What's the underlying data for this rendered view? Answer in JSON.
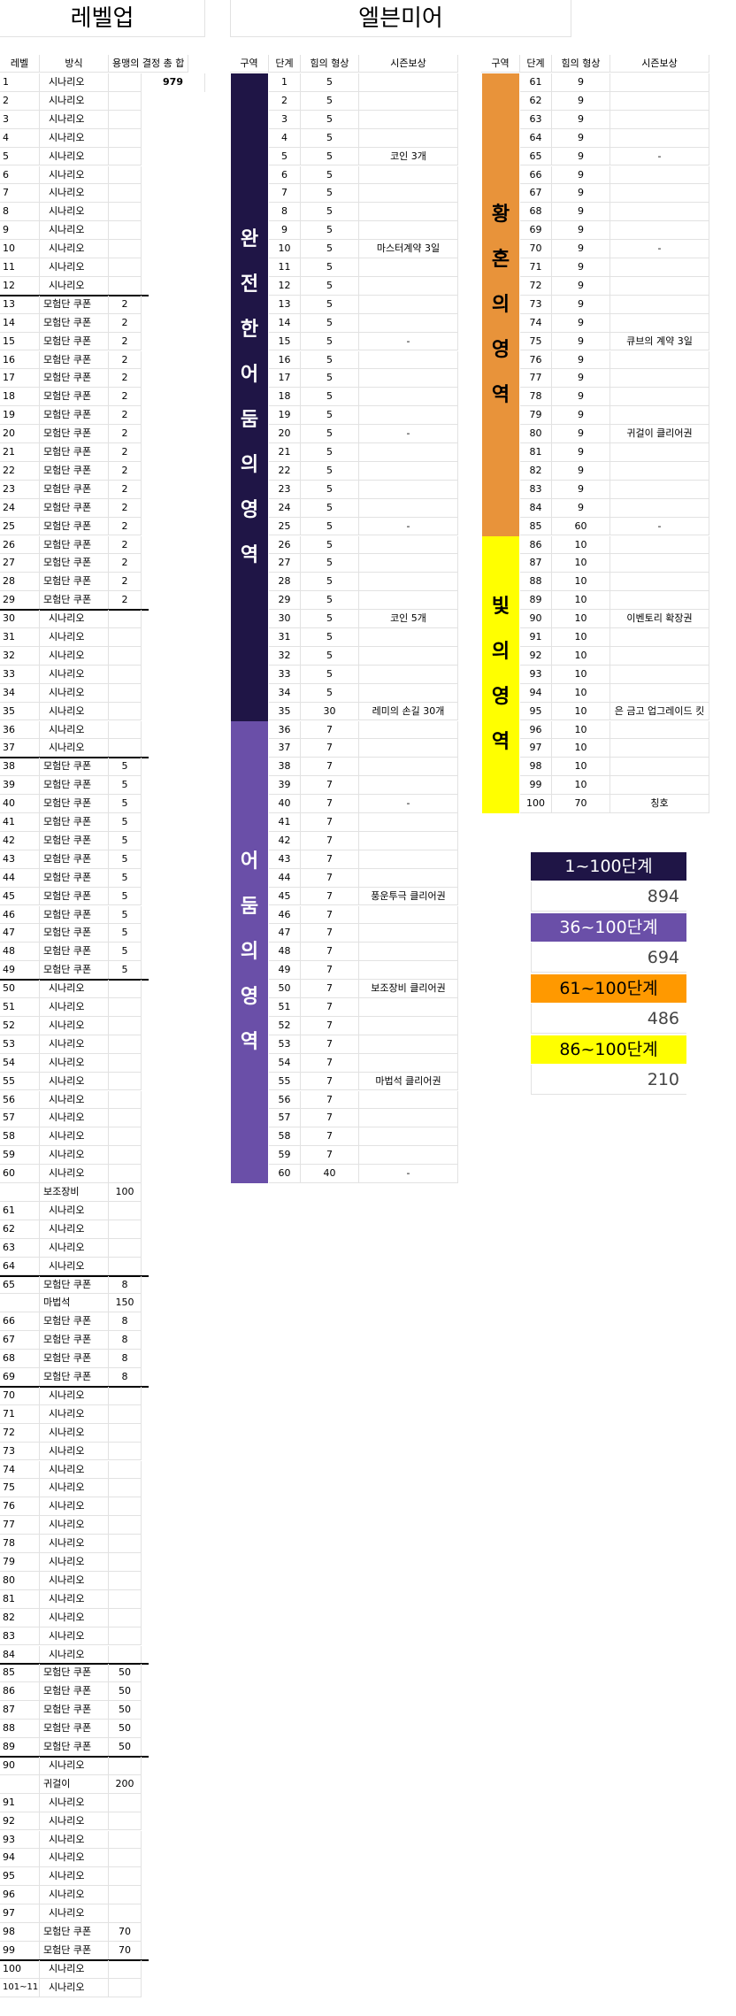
{
  "titles": {
    "left": "레벨업",
    "right": "엘븐미어"
  },
  "left_table": {
    "headers": [
      "레벨",
      "방식",
      "용맹의 결정 총 합",
      "979"
    ],
    "rows": [
      [
        "1",
        "시나리오",
        ""
      ],
      [
        "2",
        "시나리오",
        ""
      ],
      [
        "3",
        "시나리오",
        ""
      ],
      [
        "4",
        "시나리오",
        ""
      ],
      [
        "5",
        "시나리오",
        ""
      ],
      [
        "6",
        "시나리오",
        ""
      ],
      [
        "7",
        "시나리오",
        ""
      ],
      [
        "8",
        "시나리오",
        ""
      ],
      [
        "9",
        "시나리오",
        ""
      ],
      [
        "10",
        "시나리오",
        ""
      ],
      [
        "11",
        "시나리오",
        ""
      ],
      [
        "12",
        "시나리오",
        ""
      ],
      [
        "13",
        "모험단 쿠폰",
        "2"
      ],
      [
        "14",
        "모험단 쿠폰",
        "2"
      ],
      [
        "15",
        "모험단 쿠폰",
        "2"
      ],
      [
        "16",
        "모험단 쿠폰",
        "2"
      ],
      [
        "17",
        "모험단 쿠폰",
        "2"
      ],
      [
        "18",
        "모험단 쿠폰",
        "2"
      ],
      [
        "19",
        "모험단 쿠폰",
        "2"
      ],
      [
        "20",
        "모험단 쿠폰",
        "2"
      ],
      [
        "21",
        "모험단 쿠폰",
        "2"
      ],
      [
        "22",
        "모험단 쿠폰",
        "2"
      ],
      [
        "23",
        "모험단 쿠폰",
        "2"
      ],
      [
        "24",
        "모험단 쿠폰",
        "2"
      ],
      [
        "25",
        "모험단 쿠폰",
        "2"
      ],
      [
        "26",
        "모험단 쿠폰",
        "2"
      ],
      [
        "27",
        "모험단 쿠폰",
        "2"
      ],
      [
        "28",
        "모험단 쿠폰",
        "2"
      ],
      [
        "29",
        "모험단 쿠폰",
        "2"
      ],
      [
        "30",
        "시나리오",
        ""
      ],
      [
        "31",
        "시나리오",
        ""
      ],
      [
        "32",
        "시나리오",
        ""
      ],
      [
        "33",
        "시나리오",
        ""
      ],
      [
        "34",
        "시나리오",
        ""
      ],
      [
        "35",
        "시나리오",
        ""
      ],
      [
        "36",
        "시나리오",
        ""
      ],
      [
        "37",
        "시나리오",
        ""
      ],
      [
        "38",
        "모험단 쿠폰",
        "5"
      ],
      [
        "39",
        "모험단 쿠폰",
        "5"
      ],
      [
        "40",
        "모험단 쿠폰",
        "5"
      ],
      [
        "41",
        "모험단 쿠폰",
        "5"
      ],
      [
        "42",
        "모험단 쿠폰",
        "5"
      ],
      [
        "43",
        "모험단 쿠폰",
        "5"
      ],
      [
        "44",
        "모험단 쿠폰",
        "5"
      ],
      [
        "45",
        "모험단 쿠폰",
        "5"
      ],
      [
        "46",
        "모험단 쿠폰",
        "5"
      ],
      [
        "47",
        "모험단 쿠폰",
        "5"
      ],
      [
        "48",
        "모험단 쿠폰",
        "5"
      ],
      [
        "49",
        "모험단 쿠폰",
        "5"
      ],
      [
        "50",
        "시나리오",
        ""
      ],
      [
        "51",
        "시나리오",
        ""
      ],
      [
        "52",
        "시나리오",
        ""
      ],
      [
        "53",
        "시나리오",
        ""
      ],
      [
        "54",
        "시나리오",
        ""
      ],
      [
        "55",
        "시나리오",
        ""
      ],
      [
        "56",
        "시나리오",
        ""
      ],
      [
        "57",
        "시나리오",
        ""
      ],
      [
        "58",
        "시나리오",
        ""
      ],
      [
        "59",
        "시나리오",
        ""
      ],
      [
        "60",
        "시나리오",
        ""
      ],
      [
        "",
        "보조장비",
        "100"
      ],
      [
        "61",
        "시나리오",
        ""
      ],
      [
        "62",
        "시나리오",
        ""
      ],
      [
        "63",
        "시나리오",
        ""
      ],
      [
        "64",
        "시나리오",
        ""
      ],
      [
        "65",
        "모험단 쿠폰",
        "8"
      ],
      [
        "",
        "마법석",
        "150"
      ],
      [
        "66",
        "모험단 쿠폰",
        "8"
      ],
      [
        "67",
        "모험단 쿠폰",
        "8"
      ],
      [
        "68",
        "모험단 쿠폰",
        "8"
      ],
      [
        "69",
        "모험단 쿠폰",
        "8"
      ],
      [
        "70",
        "시나리오",
        ""
      ],
      [
        "71",
        "시나리오",
        ""
      ],
      [
        "72",
        "시나리오",
        ""
      ],
      [
        "73",
        "시나리오",
        ""
      ],
      [
        "74",
        "시나리오",
        ""
      ],
      [
        "75",
        "시나리오",
        ""
      ],
      [
        "76",
        "시나리오",
        ""
      ],
      [
        "77",
        "시나리오",
        ""
      ],
      [
        "78",
        "시나리오",
        ""
      ],
      [
        "79",
        "시나리오",
        ""
      ],
      [
        "80",
        "시나리오",
        ""
      ],
      [
        "81",
        "시나리오",
        ""
      ],
      [
        "82",
        "시나리오",
        ""
      ],
      [
        "83",
        "시나리오",
        ""
      ],
      [
        "84",
        "시나리오",
        ""
      ],
      [
        "85",
        "모험단 쿠폰",
        "50"
      ],
      [
        "86",
        "모험단 쿠폰",
        "50"
      ],
      [
        "87",
        "모험단 쿠폰",
        "50"
      ],
      [
        "88",
        "모험단 쿠폰",
        "50"
      ],
      [
        "89",
        "모험단 쿠폰",
        "50"
      ],
      [
        "90",
        "시나리오",
        ""
      ],
      [
        "",
        "귀걸이",
        "200"
      ],
      [
        "91",
        "시나리오",
        ""
      ],
      [
        "92",
        "시나리오",
        ""
      ],
      [
        "93",
        "시나리오",
        ""
      ],
      [
        "94",
        "시나리오",
        ""
      ],
      [
        "95",
        "시나리오",
        ""
      ],
      [
        "96",
        "시나리오",
        ""
      ],
      [
        "97",
        "시나리오",
        ""
      ],
      [
        "98",
        "모험단 쿠폰",
        "70"
      ],
      [
        "99",
        "모험단 쿠폰",
        "70"
      ],
      [
        "100",
        "시나리오",
        ""
      ],
      [
        "101~11",
        "시나리오",
        ""
      ]
    ]
  },
  "elvenmere_headers": [
    "구역",
    "단계",
    "힘의 형상",
    "시즌보상"
  ],
  "zones": [
    {
      "name": "완전한 어둠의 영역",
      "color": "#1f1546",
      "text_color": "#ffffff"
    },
    {
      "name": "어둠의 영역",
      "color": "#6a4fa8",
      "text_color": "#ffffff"
    },
    {
      "name": "황혼의 영역",
      "color": "#e8933a",
      "text_color": "#000000"
    },
    {
      "name": "빛의 영역",
      "color": "#ffff00",
      "text_color": "#000000"
    }
  ],
  "stages_a": [
    [
      "1",
      "5",
      ""
    ],
    [
      "2",
      "5",
      ""
    ],
    [
      "3",
      "5",
      ""
    ],
    [
      "4",
      "5",
      ""
    ],
    [
      "5",
      "5",
      "코인 3개"
    ],
    [
      "6",
      "5",
      ""
    ],
    [
      "7",
      "5",
      ""
    ],
    [
      "8",
      "5",
      ""
    ],
    [
      "9",
      "5",
      ""
    ],
    [
      "10",
      "5",
      "마스터계약 3일"
    ],
    [
      "11",
      "5",
      ""
    ],
    [
      "12",
      "5",
      ""
    ],
    [
      "13",
      "5",
      ""
    ],
    [
      "14",
      "5",
      ""
    ],
    [
      "15",
      "5",
      "-"
    ],
    [
      "16",
      "5",
      ""
    ],
    [
      "17",
      "5",
      ""
    ],
    [
      "18",
      "5",
      ""
    ],
    [
      "19",
      "5",
      ""
    ],
    [
      "20",
      "5",
      "-"
    ],
    [
      "21",
      "5",
      ""
    ],
    [
      "22",
      "5",
      ""
    ],
    [
      "23",
      "5",
      ""
    ],
    [
      "24",
      "5",
      ""
    ],
    [
      "25",
      "5",
      "-"
    ],
    [
      "26",
      "5",
      ""
    ],
    [
      "27",
      "5",
      ""
    ],
    [
      "28",
      "5",
      ""
    ],
    [
      "29",
      "5",
      ""
    ],
    [
      "30",
      "5",
      "코인 5개"
    ],
    [
      "31",
      "5",
      ""
    ],
    [
      "32",
      "5",
      ""
    ],
    [
      "33",
      "5",
      ""
    ],
    [
      "34",
      "5",
      ""
    ],
    [
      "35",
      "30",
      "레미의 손길 30개"
    ],
    [
      "36",
      "7",
      ""
    ],
    [
      "37",
      "7",
      ""
    ],
    [
      "38",
      "7",
      ""
    ],
    [
      "39",
      "7",
      ""
    ],
    [
      "40",
      "7",
      "-"
    ],
    [
      "41",
      "7",
      ""
    ],
    [
      "42",
      "7",
      ""
    ],
    [
      "43",
      "7",
      ""
    ],
    [
      "44",
      "7",
      ""
    ],
    [
      "45",
      "7",
      "풍운투극 클리어권"
    ],
    [
      "46",
      "7",
      ""
    ],
    [
      "47",
      "7",
      ""
    ],
    [
      "48",
      "7",
      ""
    ],
    [
      "49",
      "7",
      ""
    ],
    [
      "50",
      "7",
      "보조장비 클리어권"
    ],
    [
      "51",
      "7",
      ""
    ],
    [
      "52",
      "7",
      ""
    ],
    [
      "53",
      "7",
      ""
    ],
    [
      "54",
      "7",
      ""
    ],
    [
      "55",
      "7",
      "마법석 클리어권"
    ],
    [
      "56",
      "7",
      ""
    ],
    [
      "57",
      "7",
      ""
    ],
    [
      "58",
      "7",
      ""
    ],
    [
      "59",
      "7",
      ""
    ],
    [
      "60",
      "40",
      "-"
    ]
  ],
  "stages_b": [
    [
      "61",
      "9",
      ""
    ],
    [
      "62",
      "9",
      ""
    ],
    [
      "63",
      "9",
      ""
    ],
    [
      "64",
      "9",
      ""
    ],
    [
      "65",
      "9",
      "-"
    ],
    [
      "66",
      "9",
      ""
    ],
    [
      "67",
      "9",
      ""
    ],
    [
      "68",
      "9",
      ""
    ],
    [
      "69",
      "9",
      ""
    ],
    [
      "70",
      "9",
      "-"
    ],
    [
      "71",
      "9",
      ""
    ],
    [
      "72",
      "9",
      ""
    ],
    [
      "73",
      "9",
      ""
    ],
    [
      "74",
      "9",
      ""
    ],
    [
      "75",
      "9",
      "큐브의 계약 3일"
    ],
    [
      "76",
      "9",
      ""
    ],
    [
      "77",
      "9",
      ""
    ],
    [
      "78",
      "9",
      ""
    ],
    [
      "79",
      "9",
      ""
    ],
    [
      "80",
      "9",
      "귀걸이 클리어권"
    ],
    [
      "81",
      "9",
      ""
    ],
    [
      "82",
      "9",
      ""
    ],
    [
      "83",
      "9",
      ""
    ],
    [
      "84",
      "9",
      ""
    ],
    [
      "85",
      "60",
      "-"
    ],
    [
      "86",
      "10",
      ""
    ],
    [
      "87",
      "10",
      ""
    ],
    [
      "88",
      "10",
      ""
    ],
    [
      "89",
      "10",
      ""
    ],
    [
      "90",
      "10",
      "이벤토리 확장권"
    ],
    [
      "91",
      "10",
      ""
    ],
    [
      "92",
      "10",
      ""
    ],
    [
      "93",
      "10",
      ""
    ],
    [
      "94",
      "10",
      ""
    ],
    [
      "95",
      "10",
      "은 금고 업그레이드 킷"
    ],
    [
      "96",
      "10",
      ""
    ],
    [
      "97",
      "10",
      ""
    ],
    [
      "98",
      "10",
      ""
    ],
    [
      "99",
      "10",
      ""
    ],
    [
      "100",
      "70",
      "칭호"
    ]
  ],
  "summary": [
    {
      "label": "1~100단계",
      "value": "894",
      "bg": "#1f1546",
      "fg": "#ffffff"
    },
    {
      "label": "36~100단계",
      "value": "694",
      "bg": "#6a4fa8",
      "fg": "#ffffff"
    },
    {
      "label": "61~100단계",
      "value": "486",
      "bg": "#ff9900",
      "fg": "#000000"
    },
    {
      "label": "86~100단계",
      "value": "210",
      "bg": "#ffff00",
      "fg": "#000000"
    }
  ]
}
